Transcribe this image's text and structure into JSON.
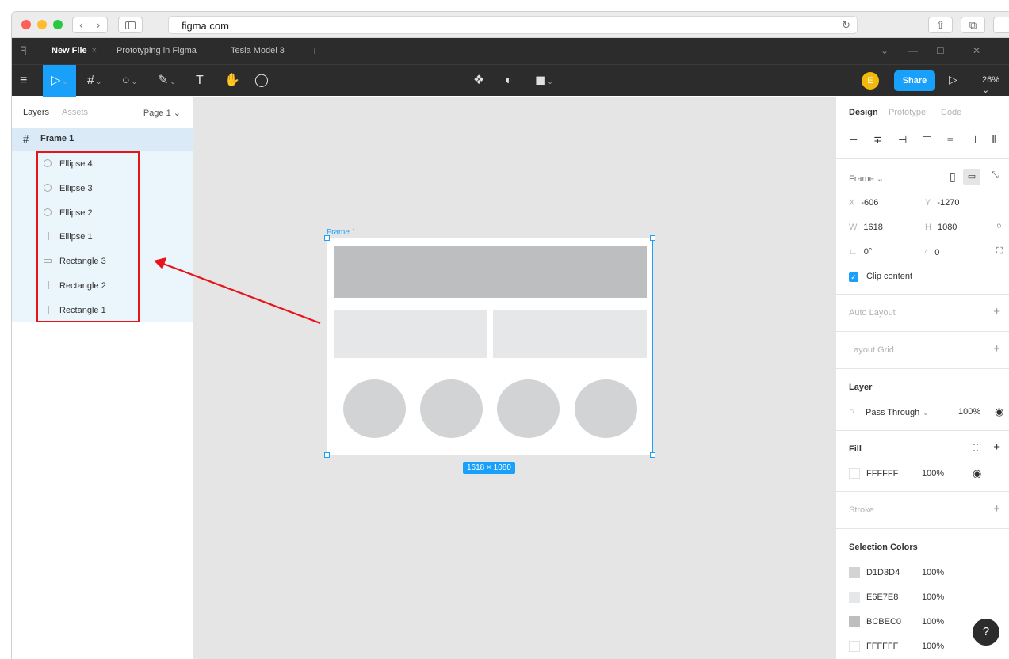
{
  "browser": {
    "url": "figma.com"
  },
  "figma_tabs": [
    {
      "label": "New File",
      "active": true
    },
    {
      "label": "Prototyping in Figma",
      "active": false
    },
    {
      "label": "Tesla Model 3",
      "active": false
    }
  ],
  "toolbar": {
    "avatar_initial": "E",
    "share_label": "Share",
    "zoom": "26%",
    "text_tool": "T"
  },
  "layers_panel": {
    "tabs": [
      "Layers",
      "Assets"
    ],
    "page_selector": "Page 1",
    "frame": "Frame 1",
    "children": [
      {
        "name": "Ellipse 4",
        "icon": "ellipse-icon"
      },
      {
        "name": "Ellipse 3",
        "icon": "ellipse-icon"
      },
      {
        "name": "Ellipse 2",
        "icon": "ellipse-icon"
      },
      {
        "name": "Ellipse 1",
        "icon": "vertical-line-icon"
      },
      {
        "name": "Rectangle 3",
        "icon": "rectangle-icon"
      },
      {
        "name": "Rectangle 2",
        "icon": "vertical-line-icon"
      },
      {
        "name": "Rectangle 1",
        "icon": "vertical-line-icon"
      }
    ]
  },
  "canvas": {
    "frame_label": "Frame 1",
    "dimensions": "1618 × 1080",
    "colors": {
      "rect3": "#BCBEC0",
      "rect12": "#E6E7E8",
      "ellipse": "#D1D3D4",
      "selection": "#18A0FB"
    }
  },
  "design_panel": {
    "tabs": [
      "Design",
      "Prototype",
      "Code"
    ],
    "frame_type": "Frame",
    "x_label": "X",
    "x": "-606",
    "y_label": "Y",
    "y": "-1270",
    "w_label": "W",
    "w": "1618",
    "h_label": "H",
    "h": "1080",
    "rotation": "0°",
    "radius": "0",
    "clip_content": "Clip content",
    "auto_layout": "Auto Layout",
    "layout_grid": "Layout Grid",
    "layer_title": "Layer",
    "blend_mode": "Pass Through",
    "layer_opacity": "100%",
    "fill_title": "Fill",
    "fill_hex": "FFFFFF",
    "fill_opacity": "100%",
    "stroke_title": "Stroke",
    "selection_colors_title": "Selection Colors",
    "selection_colors": [
      {
        "hex": "D1D3D4",
        "opacity": "100%",
        "swatch": "#D1D3D4"
      },
      {
        "hex": "E6E7E8",
        "opacity": "100%",
        "swatch": "#E6E7E8"
      },
      {
        "hex": "BCBEC0",
        "opacity": "100%",
        "swatch": "#BCBEC0"
      },
      {
        "hex": "FFFFFF",
        "opacity": "100%",
        "swatch": "#FFFFFF"
      }
    ]
  },
  "help_label": "?"
}
